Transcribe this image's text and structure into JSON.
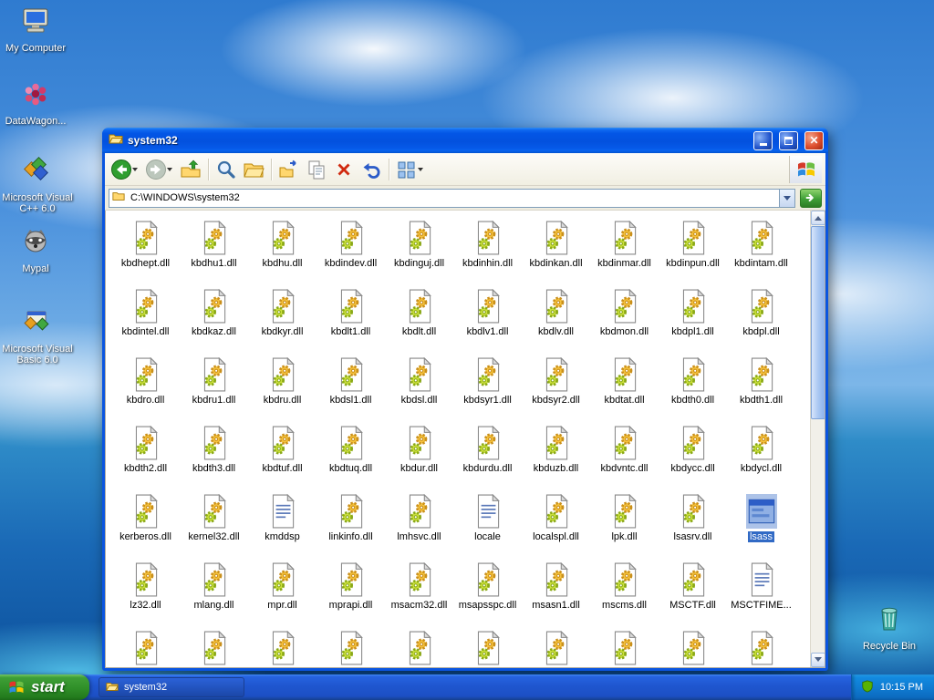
{
  "desktop": {
    "icons": [
      {
        "label": "My Computer"
      },
      {
        "label": "DataWagon..."
      },
      {
        "label": "Microsoft Visual C++ 6.0"
      },
      {
        "label": "Mypal"
      },
      {
        "label": "Microsoft Visual Basic 6.0"
      }
    ],
    "recycle_bin_label": "Recycle Bin"
  },
  "window": {
    "title": "system32",
    "address": "C:\\WINDOWS\\system32",
    "toolbar_buttons": [
      "back",
      "forward",
      "up",
      "search",
      "folders",
      "move-to",
      "copy-to",
      "delete",
      "undo",
      "views"
    ],
    "files": [
      {
        "name": "kbdhept.dll",
        "icon": "dll"
      },
      {
        "name": "kbdhu1.dll",
        "icon": "dll"
      },
      {
        "name": "kbdhu.dll",
        "icon": "dll"
      },
      {
        "name": "kbdindev.dll",
        "icon": "dll"
      },
      {
        "name": "kbdinguj.dll",
        "icon": "dll"
      },
      {
        "name": "kbdinhin.dll",
        "icon": "dll"
      },
      {
        "name": "kbdinkan.dll",
        "icon": "dll"
      },
      {
        "name": "kbdinmar.dll",
        "icon": "dll"
      },
      {
        "name": "kbdinpun.dll",
        "icon": "dll"
      },
      {
        "name": "kbdintam.dll",
        "icon": "dll"
      },
      {
        "name": "kbdintel.dll",
        "icon": "dll"
      },
      {
        "name": "kbdkaz.dll",
        "icon": "dll"
      },
      {
        "name": "kbdkyr.dll",
        "icon": "dll"
      },
      {
        "name": "kbdlt1.dll",
        "icon": "dll"
      },
      {
        "name": "kbdlt.dll",
        "icon": "dll"
      },
      {
        "name": "kbdlv1.dll",
        "icon": "dll"
      },
      {
        "name": "kbdlv.dll",
        "icon": "dll"
      },
      {
        "name": "kbdmon.dll",
        "icon": "dll"
      },
      {
        "name": "kbdpl1.dll",
        "icon": "dll"
      },
      {
        "name": "kbdpl.dll",
        "icon": "dll"
      },
      {
        "name": "kbdro.dll",
        "icon": "dll"
      },
      {
        "name": "kbdru1.dll",
        "icon": "dll"
      },
      {
        "name": "kbdru.dll",
        "icon": "dll"
      },
      {
        "name": "kbdsl1.dll",
        "icon": "dll"
      },
      {
        "name": "kbdsl.dll",
        "icon": "dll"
      },
      {
        "name": "kbdsyr1.dll",
        "icon": "dll"
      },
      {
        "name": "kbdsyr2.dll",
        "icon": "dll"
      },
      {
        "name": "kbdtat.dll",
        "icon": "dll"
      },
      {
        "name": "kbdth0.dll",
        "icon": "dll"
      },
      {
        "name": "kbdth1.dll",
        "icon": "dll"
      },
      {
        "name": "kbdth2.dll",
        "icon": "dll"
      },
      {
        "name": "kbdth3.dll",
        "icon": "dll"
      },
      {
        "name": "kbdtuf.dll",
        "icon": "dll"
      },
      {
        "name": "kbdtuq.dll",
        "icon": "dll"
      },
      {
        "name": "kbdur.dll",
        "icon": "dll"
      },
      {
        "name": "kbdurdu.dll",
        "icon": "dll"
      },
      {
        "name": "kbduzb.dll",
        "icon": "dll"
      },
      {
        "name": "kbdvntc.dll",
        "icon": "dll"
      },
      {
        "name": "kbdycc.dll",
        "icon": "dll"
      },
      {
        "name": "kbdycl.dll",
        "icon": "dll"
      },
      {
        "name": "kerberos.dll",
        "icon": "dll"
      },
      {
        "name": "kernel32.dll",
        "icon": "dll"
      },
      {
        "name": "kmddsp",
        "icon": "text"
      },
      {
        "name": "linkinfo.dll",
        "icon": "dll"
      },
      {
        "name": "lmhsvc.dll",
        "icon": "dll"
      },
      {
        "name": "locale",
        "icon": "text"
      },
      {
        "name": "localspl.dll",
        "icon": "dll"
      },
      {
        "name": "lpk.dll",
        "icon": "dll"
      },
      {
        "name": "lsasrv.dll",
        "icon": "dll"
      },
      {
        "name": "lsass",
        "icon": "app",
        "selected": true
      },
      {
        "name": "lz32.dll",
        "icon": "dll"
      },
      {
        "name": "mlang.dll",
        "icon": "dll"
      },
      {
        "name": "mpr.dll",
        "icon": "dll"
      },
      {
        "name": "mprapi.dll",
        "icon": "dll"
      },
      {
        "name": "msacm32.dll",
        "icon": "dll"
      },
      {
        "name": "msapsspc.dll",
        "icon": "dll"
      },
      {
        "name": "msasn1.dll",
        "icon": "dll"
      },
      {
        "name": "mscms.dll",
        "icon": "dll"
      },
      {
        "name": "MSCTF.dll",
        "icon": "dll"
      },
      {
        "name": "MSCTFIME...",
        "icon": "text"
      },
      {
        "name": "",
        "icon": "dll"
      },
      {
        "name": "",
        "icon": "dll"
      },
      {
        "name": "",
        "icon": "dll"
      },
      {
        "name": "",
        "icon": "dll"
      },
      {
        "name": "",
        "icon": "dll"
      },
      {
        "name": "",
        "icon": "dll"
      },
      {
        "name": "",
        "icon": "dll"
      },
      {
        "name": "",
        "icon": "dll"
      },
      {
        "name": "",
        "icon": "dll"
      },
      {
        "name": "",
        "icon": "dll"
      }
    ]
  },
  "taskbar": {
    "start_label": "start",
    "task_label": "system32",
    "clock": "10:15 PM"
  }
}
